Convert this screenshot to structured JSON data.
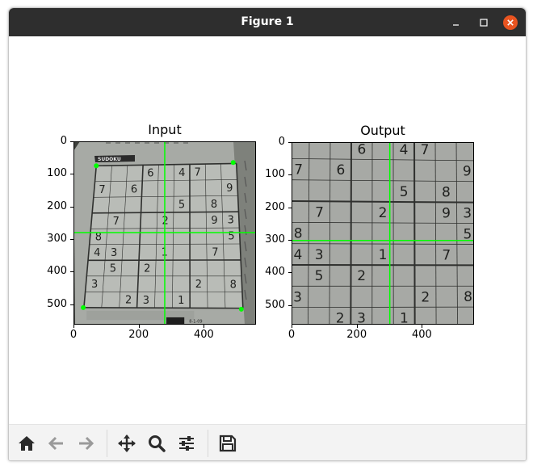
{
  "window": {
    "title": "Figure 1"
  },
  "toolbar": {
    "buttons": [
      {
        "name": "home",
        "icon": "home-icon"
      },
      {
        "name": "back",
        "icon": "arrow-left-icon"
      },
      {
        "name": "forward",
        "icon": "arrow-right-icon"
      },
      {
        "name": "pan",
        "icon": "move-icon"
      },
      {
        "name": "zoom",
        "icon": "magnifier-icon"
      },
      {
        "name": "configure",
        "icon": "sliders-icon"
      },
      {
        "name": "save",
        "icon": "floppy-disk-icon"
      }
    ]
  },
  "colors": {
    "titlebar": "#2e2e2e",
    "close_button": "#e95420",
    "marker_green": "#00ff00",
    "toolbar_bg": "#f3f3f3"
  },
  "axes": {
    "input": {
      "title": "Input",
      "x_ticks": [
        "0",
        "200",
        "400"
      ],
      "y_ticks": [
        "0",
        "100",
        "200",
        "300",
        "400",
        "500"
      ],
      "corner_points": [
        [
          70,
          75
        ],
        [
          490,
          65
        ],
        [
          30,
          510
        ],
        [
          515,
          515
        ]
      ],
      "crosshair": {
        "x": 280,
        "y": 280
      },
      "puzzle_header": "SUDOKU",
      "footer_text": "8-1-09"
    },
    "output": {
      "title": "Output",
      "x_ticks": [
        "0",
        "200",
        "400"
      ],
      "y_ticks": [
        "0",
        "100",
        "200",
        "300",
        "400",
        "500"
      ],
      "crosshair": {
        "x": 280,
        "y": 280
      }
    }
  },
  "sudoku": {
    "digits": [
      [
        "",
        "",
        "",
        "6",
        "",
        "4",
        "7",
        "",
        ""
      ],
      [
        "7",
        "",
        "6",
        "",
        "",
        "",
        "",
        "",
        "9"
      ],
      [
        "",
        "",
        "",
        "",
        "",
        "5",
        "",
        "8",
        ""
      ],
      [
        "",
        "7",
        "",
        "",
        "2",
        "",
        "",
        "9",
        "3"
      ],
      [
        "8",
        "",
        "",
        "",
        "",
        "",
        "",
        "",
        "5"
      ],
      [
        "4",
        "3",
        "",
        "",
        "1",
        "",
        "",
        "7",
        ""
      ],
      [
        "",
        "5",
        "",
        "2",
        "",
        "",
        "",
        "",
        ""
      ],
      [
        "3",
        "",
        "",
        "",
        "",
        "",
        "2",
        "",
        "8"
      ],
      [
        "",
        "",
        "2",
        "3",
        "",
        "1",
        "",
        "",
        ""
      ]
    ]
  }
}
